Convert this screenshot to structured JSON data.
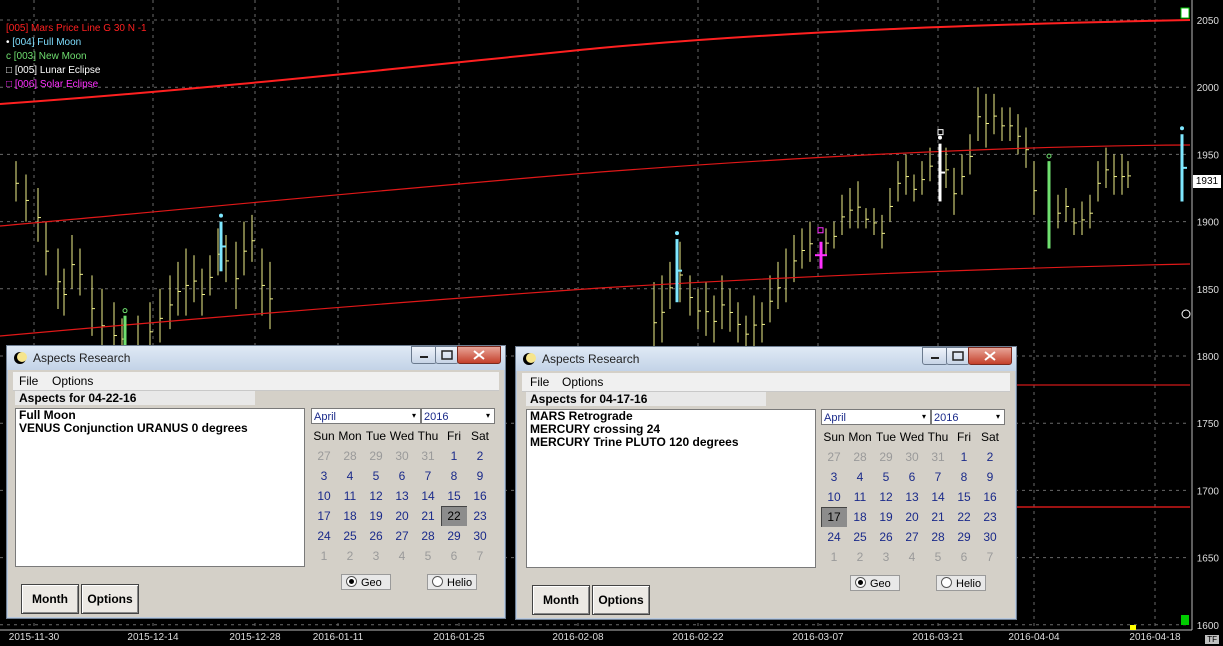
{
  "chart": {
    "legend": [
      {
        "text": "[005] Mars Price Line G 30 N -1",
        "color": "#ff2020"
      },
      {
        "text": "[004] Full Moon",
        "color": "#7fdfff"
      },
      {
        "text": "[003] New Moon",
        "color": "#6fdf6f"
      },
      {
        "text": "[005] Lunar Eclipse",
        "color": "#ffffff"
      },
      {
        "text": "[006] Solar Eclipse",
        "color": "#ff30ff"
      }
    ],
    "price_labels": [
      "2050",
      "2000",
      "1950",
      "1900",
      "1850",
      "1800",
      "1750",
      "1700",
      "1650",
      "1600"
    ],
    "date_labels": [
      "2015-11-30",
      "2015-12-14",
      "2015-12-28",
      "2016-01-11",
      "2016-01-25",
      "2016-02-08",
      "2016-02-22",
      "2016-03-07",
      "2016-03-21",
      "2016-04-04",
      "2016-04-18"
    ],
    "current_price": "1931",
    "corner_label": "TF",
    "colors": {
      "background": "#000000",
      "bars": "#f0f08a",
      "mars_line": "#ff2020",
      "grid": "#7a7a7a"
    }
  },
  "windows": [
    {
      "title": "Aspects Research",
      "menu": [
        "File",
        "Options"
      ],
      "header": "Aspects for 04-22-16",
      "aspects": [
        "Full Moon",
        "VENUS Conjunction URANUS  0 degrees"
      ],
      "month": "April",
      "year": "2016",
      "weekdays": [
        "Sun",
        "Mon",
        "Tue",
        "Wed",
        "Thu",
        "Fri",
        "Sat"
      ],
      "weeks": [
        [
          "27",
          "28",
          "29",
          "30",
          "31",
          "1",
          "2"
        ],
        [
          "3",
          "4",
          "5",
          "6",
          "7",
          "8",
          "9"
        ],
        [
          "10",
          "11",
          "12",
          "13",
          "14",
          "15",
          "16"
        ],
        [
          "17",
          "18",
          "19",
          "20",
          "21",
          "22",
          "23"
        ],
        [
          "24",
          "25",
          "26",
          "27",
          "28",
          "29",
          "30"
        ],
        [
          "1",
          "2",
          "3",
          "4",
          "5",
          "6",
          "7"
        ]
      ],
      "selected_day": "22",
      "geo_label": "Geo",
      "helio_label": "Helio",
      "geo_selected": true,
      "month_button": "Month",
      "options_button": "Options"
    },
    {
      "title": "Aspects Research",
      "menu": [
        "File",
        "Options"
      ],
      "header": "Aspects for 04-17-16",
      "aspects": [
        "MARS Retrograde",
        "MERCURY crossing 24",
        "MERCURY Trine PLUTO  120 degrees"
      ],
      "month": "April",
      "year": "2016",
      "weekdays": [
        "Sun",
        "Mon",
        "Tue",
        "Wed",
        "Thu",
        "Fri",
        "Sat"
      ],
      "weeks": [
        [
          "27",
          "28",
          "29",
          "30",
          "31",
          "1",
          "2"
        ],
        [
          "3",
          "4",
          "5",
          "6",
          "7",
          "8",
          "9"
        ],
        [
          "10",
          "11",
          "12",
          "13",
          "14",
          "15",
          "16"
        ],
        [
          "17",
          "18",
          "19",
          "20",
          "21",
          "22",
          "23"
        ],
        [
          "24",
          "25",
          "26",
          "27",
          "28",
          "29",
          "30"
        ],
        [
          "1",
          "2",
          "3",
          "4",
          "5",
          "6",
          "7"
        ]
      ],
      "selected_day": "17",
      "geo_label": "Geo",
      "helio_label": "Helio",
      "geo_selected": true,
      "month_button": "Month",
      "options_button": "Options"
    }
  ]
}
